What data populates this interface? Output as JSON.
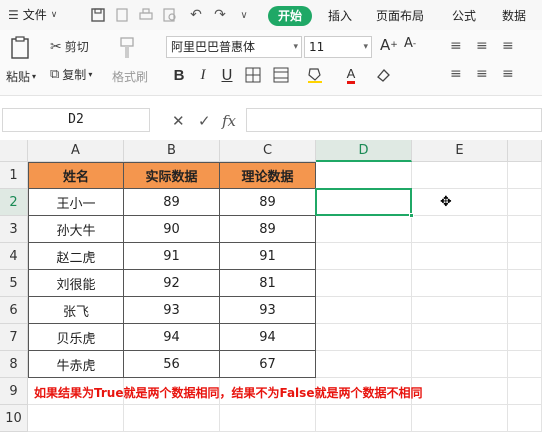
{
  "menubar": {
    "menu_label": "文件",
    "tabs": [
      "开始",
      "插入",
      "页面布局",
      "公式",
      "数据"
    ],
    "active_tab": "开始"
  },
  "ribbon": {
    "cut_label": "剪切",
    "paste_label": "粘贴",
    "copy_label": "复制",
    "format_painter_label": "格式刷",
    "font_name": "阿里巴巴普惠体",
    "font_size": "11",
    "font_color": "#e8140e"
  },
  "formula_bar": {
    "cell_ref": "D2",
    "formula": ""
  },
  "sheet": {
    "columns": [
      "A",
      "B",
      "C",
      "D",
      "E"
    ],
    "selected_column": "D",
    "rows": [
      "1",
      "2",
      "3",
      "4",
      "5",
      "6",
      "7",
      "8",
      "9",
      "10"
    ],
    "selected_row": "2",
    "headers": [
      "姓名",
      "实际数据",
      "理论数据"
    ],
    "data": [
      [
        "王小一",
        "89",
        "89"
      ],
      [
        "孙大牛",
        "90",
        "89"
      ],
      [
        "赵二虎",
        "91",
        "91"
      ],
      [
        "刘很能",
        "92",
        "81"
      ],
      [
        "张飞",
        "93",
        "93"
      ],
      [
        "贝乐虎",
        "94",
        "94"
      ],
      [
        "牛赤虎",
        "56",
        "67"
      ]
    ],
    "note": "如果结果为True就是两个数据相同，结果不为False就是两个数据不相同",
    "header_fill": "#f4964e",
    "accent": "#1fa866"
  }
}
